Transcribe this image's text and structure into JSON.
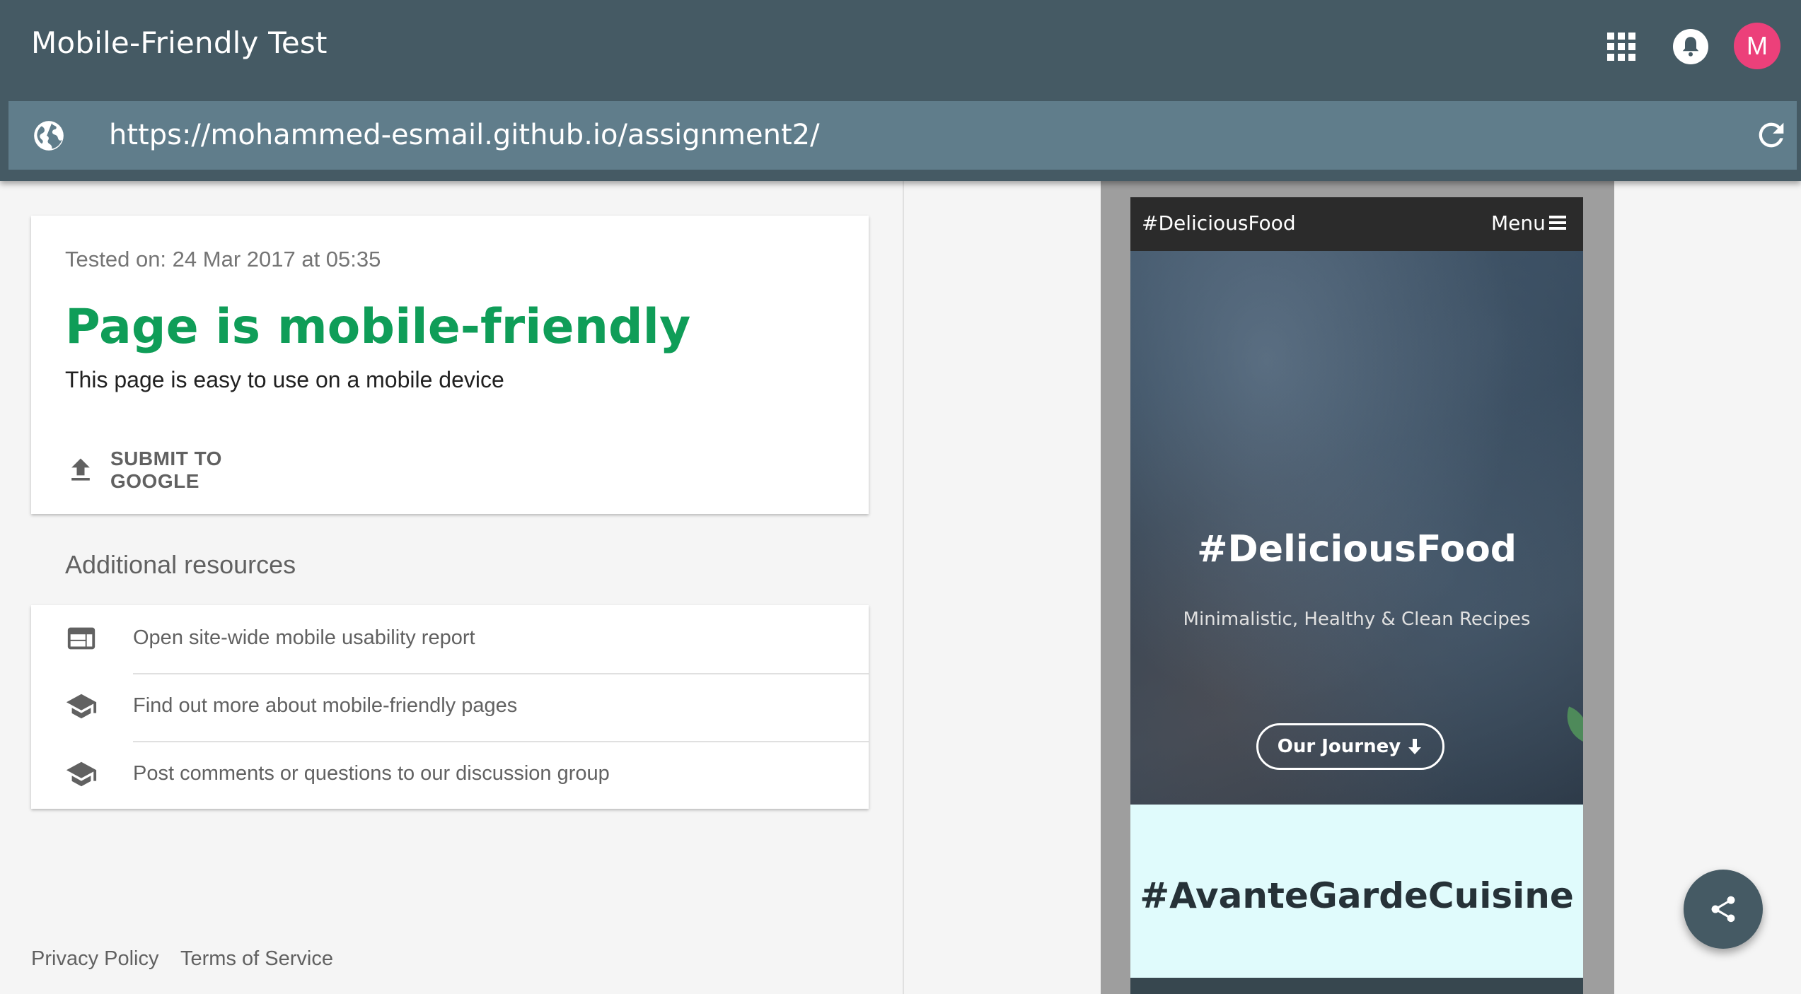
{
  "header": {
    "title": "Mobile-Friendly Test",
    "avatar_letter": "M",
    "icons": [
      "apps-icon",
      "bell-icon"
    ],
    "avatar_color": "#ec407a",
    "bar_color": "#455a64"
  },
  "url_bar": {
    "value": "https://mohammed-esmail.github.io/assignment2/",
    "icons": [
      "globe-icon",
      "refresh-icon"
    ]
  },
  "result": {
    "tested_on": "Tested on: 24 Mar 2017 at 05:35",
    "headline": "Page is mobile-friendly",
    "description": "This page is easy to use on a mobile device",
    "submit_label": "SUBMIT TO GOOGLE",
    "headline_color": "#0f9d58"
  },
  "resources": {
    "title": "Additional resources",
    "items": [
      {
        "label": "Open site-wide mobile usability report",
        "icon": "web-icon"
      },
      {
        "label": "Find out more about mobile-friendly pages",
        "icon": "school-icon"
      },
      {
        "label": "Post comments or questions to our discussion group",
        "icon": "school-icon"
      }
    ]
  },
  "footer": {
    "privacy": "Privacy Policy",
    "terms": "Terms of Service"
  },
  "preview": {
    "brand": "#DeliciousFood",
    "menu": "Menu",
    "hero_title": "#DeliciousFood",
    "hero_subtitle": "Minimalistic, Healthy & Clean Recipes",
    "journey_button": "Our Journey",
    "section_title": "#AvanteGardeCuisine"
  },
  "fab": {
    "icon": "share-icon"
  }
}
